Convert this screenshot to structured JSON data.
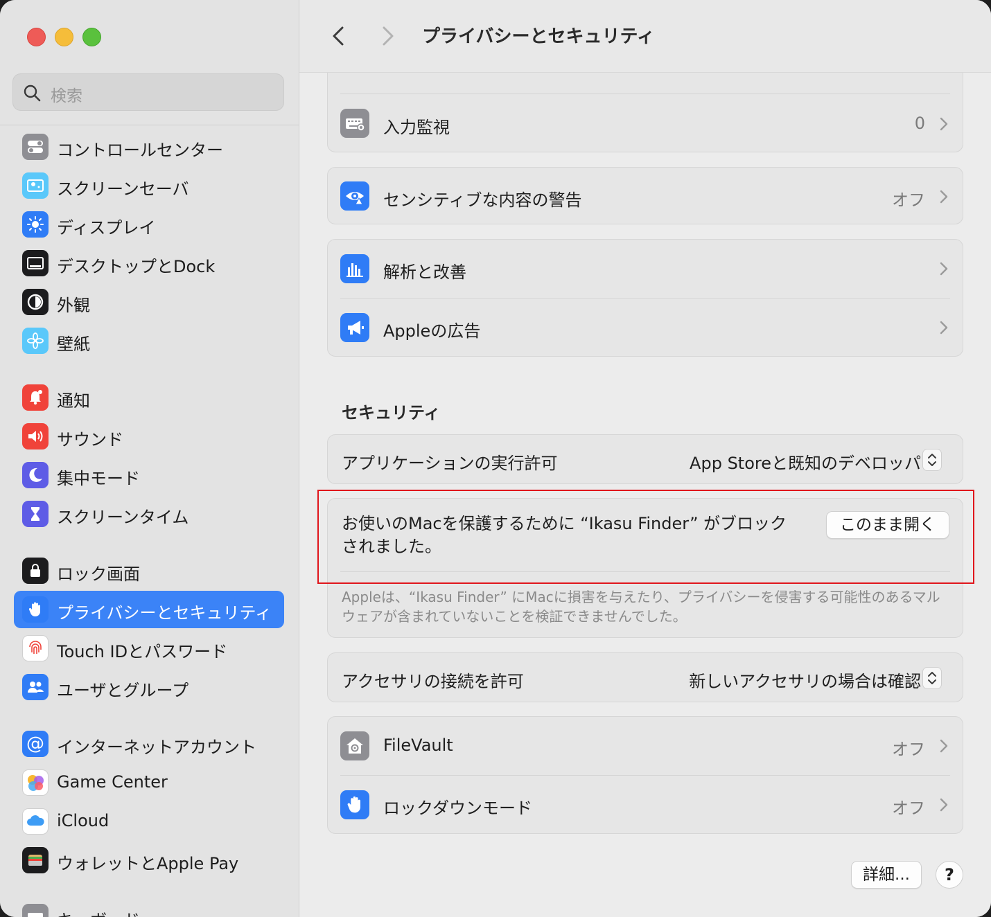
{
  "window": {
    "title": "プライバシーとセキュリティ"
  },
  "search": {
    "placeholder": "検索"
  },
  "sidebar": {
    "items": [
      {
        "label": "コントロールセンター",
        "icon": "control-center-icon",
        "color": "#8e8e93"
      },
      {
        "label": "スクリーンセーバ",
        "icon": "screen-saver-icon",
        "color": "#5ac8fa"
      },
      {
        "label": "ディスプレイ",
        "icon": "display-icon",
        "color": "#2f7cf6"
      },
      {
        "label": "デスクトップとDock",
        "icon": "desktop-dock-icon",
        "color": "#1c1c1e"
      },
      {
        "label": "外観",
        "icon": "appearance-icon",
        "color": "#1c1c1e"
      },
      {
        "label": "壁紙",
        "icon": "wallpaper-icon",
        "color": "#5ac8fa"
      },
      {
        "label": "通知",
        "icon": "notifications-icon",
        "color": "#f0433a"
      },
      {
        "label": "サウンド",
        "icon": "sound-icon",
        "color": "#f0433a"
      },
      {
        "label": "集中モード",
        "icon": "focus-moon-icon",
        "color": "#5e5ce6"
      },
      {
        "label": "スクリーンタイム",
        "icon": "screen-time-icon",
        "color": "#5e5ce6"
      },
      {
        "label": "ロック画面",
        "icon": "lock-screen-icon",
        "color": "#1c1c1e"
      },
      {
        "label": "プライバシーとセキュリティ",
        "icon": "privacy-hand-icon",
        "color": "#2f7cf6"
      },
      {
        "label": "Touch IDとパスワード",
        "icon": "touch-id-icon",
        "color": "#ffffff"
      },
      {
        "label": "ユーザとグループ",
        "icon": "users-groups-icon",
        "color": "#2f7cf6"
      },
      {
        "label": "インターネットアカウント",
        "icon": "internet-accounts-icon",
        "color": "#2f7cf6"
      },
      {
        "label": "Game Center",
        "icon": "game-center-icon",
        "color": "#ffffff"
      },
      {
        "label": "iCloud",
        "icon": "icloud-icon",
        "color": "#ffffff"
      },
      {
        "label": "ウォレットとApple Pay",
        "icon": "wallet-icon",
        "color": "#1c1c1e"
      },
      {
        "label": "キーボード",
        "icon": "keyboard-icon",
        "color": "#8e8e93"
      }
    ]
  },
  "main": {
    "input_monitoring": {
      "label": "入力監視",
      "value": "0"
    },
    "sensitive_content": {
      "label": "センシティブな内容の警告",
      "value": "オフ"
    },
    "analytics": {
      "label": "解析と改善"
    },
    "apple_ads": {
      "label": "Appleの広告"
    },
    "security_section_title": "セキュリティ",
    "app_allow": {
      "label": "アプリケーションの実行許可",
      "value": "App Storeと既知のデベロッパ"
    },
    "blocked": {
      "message": "お使いのMacを保護するために “Ikasu Finder” がブロックされました。",
      "button": "このまま開く",
      "note": "Appleは、“Ikasu Finder” にMacに損害を与えたり、プライバシーを侵害する可能性のあるマルウェアが含まれていないことを検証できませんでした。"
    },
    "accessory": {
      "label": "アクセサリの接続を許可",
      "value": "新しいアクセサリの場合は確認"
    },
    "filevault": {
      "label": "FileVault",
      "value": "オフ"
    },
    "lockdown": {
      "label": "ロックダウンモード",
      "value": "オフ"
    },
    "details_button": "詳細...",
    "help_button": "?"
  },
  "colors": {
    "accent": "#3b83f7",
    "highlight_box": "#e0151b"
  }
}
